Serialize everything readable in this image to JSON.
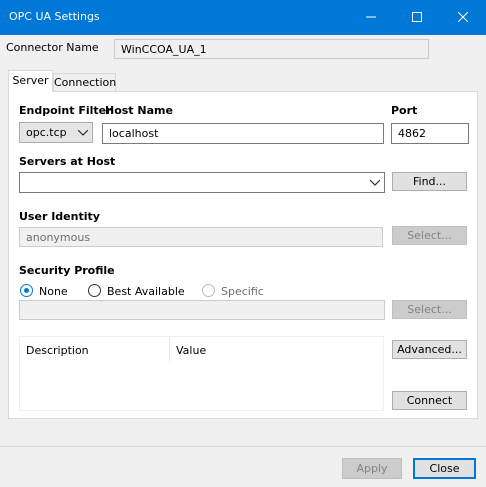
{
  "window": {
    "title": "OPC UA Settings"
  },
  "connector": {
    "label": "Connector Name",
    "value": "WinCCOA_UA_1"
  },
  "tabs": [
    {
      "label": "Server"
    },
    {
      "label": "Connection"
    }
  ],
  "server": {
    "endpoint_filter_label": "Endpoint Filter",
    "endpoint_filter_value": "opc.tcp",
    "host_name_label": "Host Name",
    "host_name_value": "localhost",
    "port_label": "Port",
    "port_value": "4862",
    "servers_at_host_label": "Servers at Host",
    "servers_at_host_value": "",
    "find_button": "Find...",
    "user_identity_label": "User Identity",
    "user_identity_value": "anonymous",
    "user_select_button": "Select...",
    "security_profile_label": "Security Profile",
    "security_options": [
      {
        "label": "None",
        "selected": true
      },
      {
        "label": "Best Available",
        "selected": false
      },
      {
        "label": "Specific",
        "selected": false,
        "disabled": true
      }
    ],
    "security_select_button": "Select...",
    "security_value": "",
    "table_headers": [
      "Description",
      "Value"
    ],
    "advanced_button": "Advanced...",
    "connect_button": "Connect"
  },
  "footer": {
    "apply_button": "Apply",
    "close_button": "Close"
  },
  "colors": {
    "titlebar": "#0078d7",
    "radio_accent": "#0078d7"
  },
  "icons": [
    "minimize-icon",
    "maximize-icon",
    "close-icon",
    "chevron-down-icon"
  ]
}
